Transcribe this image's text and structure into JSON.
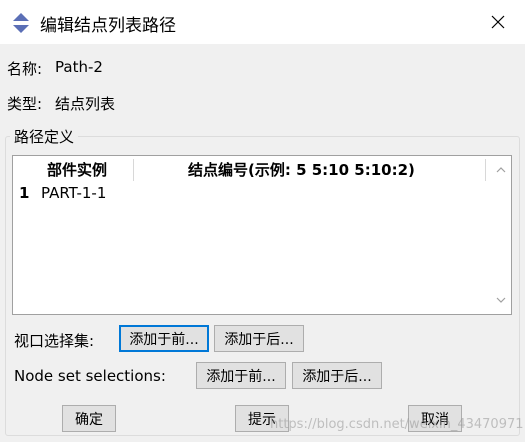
{
  "window": {
    "title": "编辑结点列表路径",
    "close_icon": "close-icon",
    "app_icon": "abaqus-logo-icon"
  },
  "fields": {
    "name_label": "名称:",
    "name_value": "Path-2",
    "type_label": "类型:",
    "type_value": "结点列表"
  },
  "path_definition": {
    "group_title": "路径定义",
    "columns": [
      "部件实例",
      "结点编号(示例: 5 5:10 5:10:2)"
    ],
    "rows": [
      {
        "index": "1",
        "part_instance": "PART-1-1",
        "node_labels": ""
      }
    ]
  },
  "viewport_selection": {
    "label": "视口选择集:",
    "add_before": "添加于前...",
    "add_after": "添加于后..."
  },
  "node_set_selection": {
    "label": "Node set selections:",
    "add_before": "添加于前...",
    "add_after": "添加于后..."
  },
  "footer": {
    "ok": "确定",
    "hint": "提示",
    "cancel": "取消"
  },
  "watermark": "https://blog.csdn.net/weixin_43470971",
  "colors": {
    "focus_border": "#0078d7",
    "dialog_bg": "#f0f0f0",
    "button_bg": "#e1e1e1",
    "logo_blue": "#5b6fb6"
  }
}
